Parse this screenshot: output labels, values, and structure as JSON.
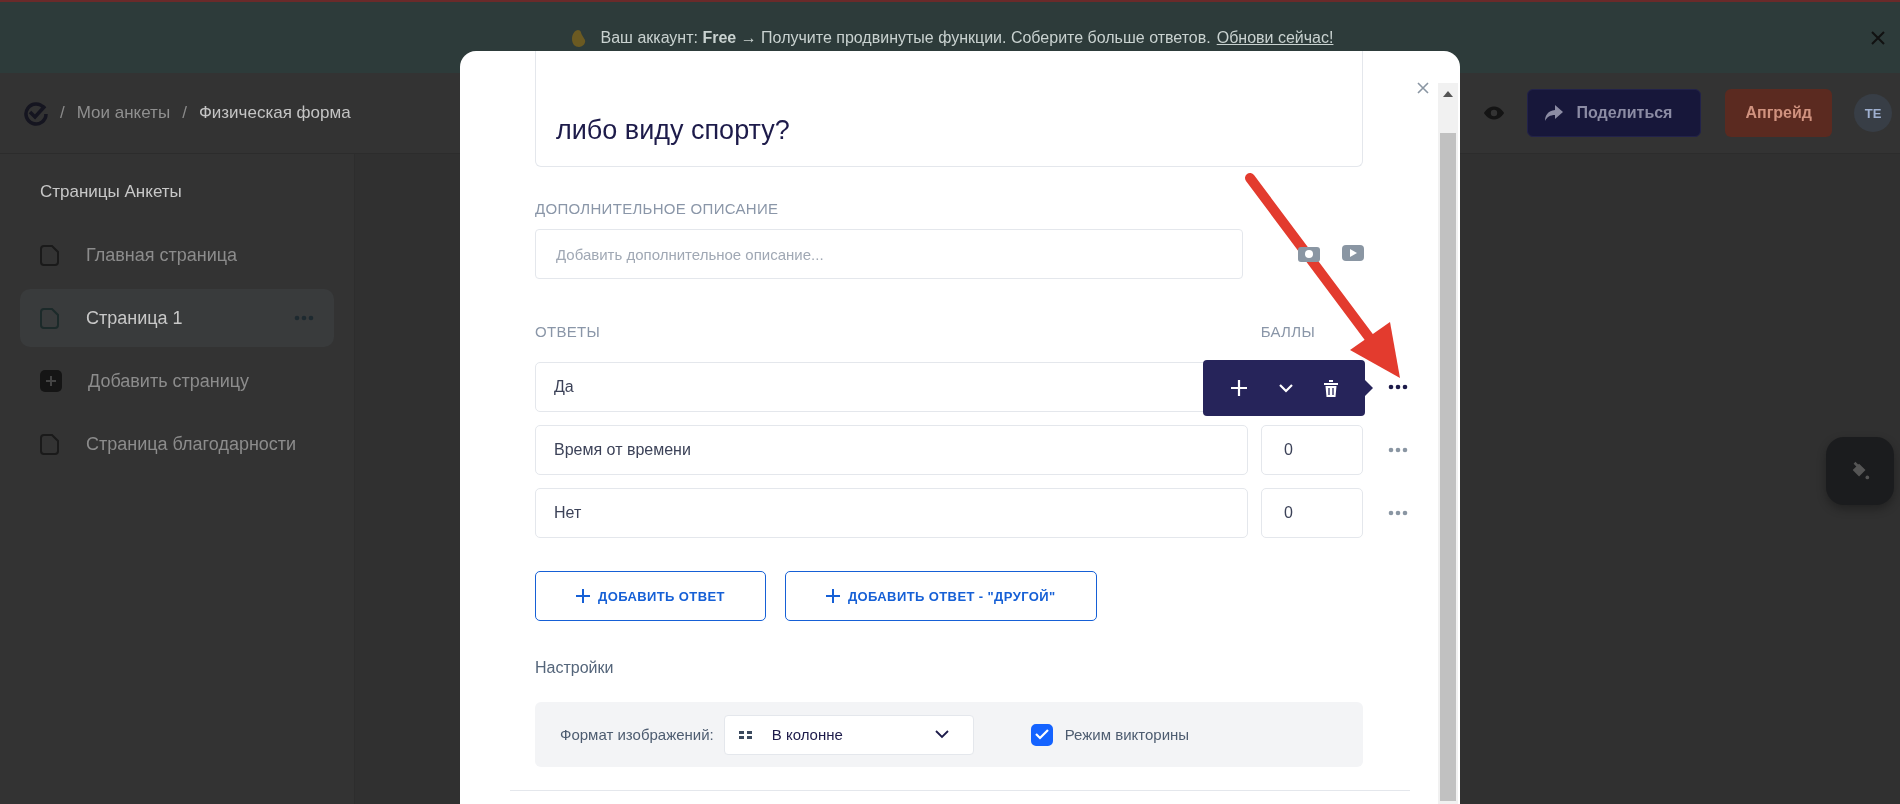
{
  "banner": {
    "message": "Ваш аккаунт: **Free** → Получите продвинутые функции. Соберите больше ответов.",
    "link": "Обнови сейчас!"
  },
  "header": {
    "breadcrumbs": [
      "Мои анкеты",
      "Физическая форма"
    ],
    "separator": "/",
    "share_button": "Поделиться",
    "upgrade_button": "Апгрейд",
    "avatar": "TE"
  },
  "sidebar": {
    "title": "Страницы Анкеты",
    "items": [
      {
        "label": "Главная страница",
        "kind": "page",
        "selected": false
      },
      {
        "label": "Страница 1",
        "kind": "page",
        "selected": true
      },
      {
        "label": "Добавить страницу",
        "kind": "add",
        "selected": false
      },
      {
        "label": "Страница благодарности",
        "kind": "page",
        "selected": false
      }
    ]
  },
  "modal": {
    "question": "либо виду спорту?",
    "description_label": "ДОПОЛНИТЕЛЬНОЕ ОПИСАНИЕ",
    "description_placeholder": "Добавить дополнительное описание...",
    "answers_label": "ОТВЕТЫ",
    "points_label": "БАЛЛЫ",
    "answers": [
      {
        "text": "Да",
        "menu_open": true
      },
      {
        "text": "Время от времени",
        "points": "0",
        "menu_open": false
      },
      {
        "text": "Нет",
        "points": "0",
        "menu_open": false
      }
    ],
    "add_buttons": [
      {
        "label": "ДОБАВИТЬ ОТВЕТ"
      },
      {
        "label": "ДОБАВИТЬ ОТВЕТ - \"ДРУГОЙ\""
      }
    ],
    "settings": {
      "title": "Настройки",
      "image_format_label": "Формат изображений:",
      "image_format": "В колонне",
      "quiz_mode": {
        "label": "Режим викторины",
        "checked": true
      }
    }
  }
}
